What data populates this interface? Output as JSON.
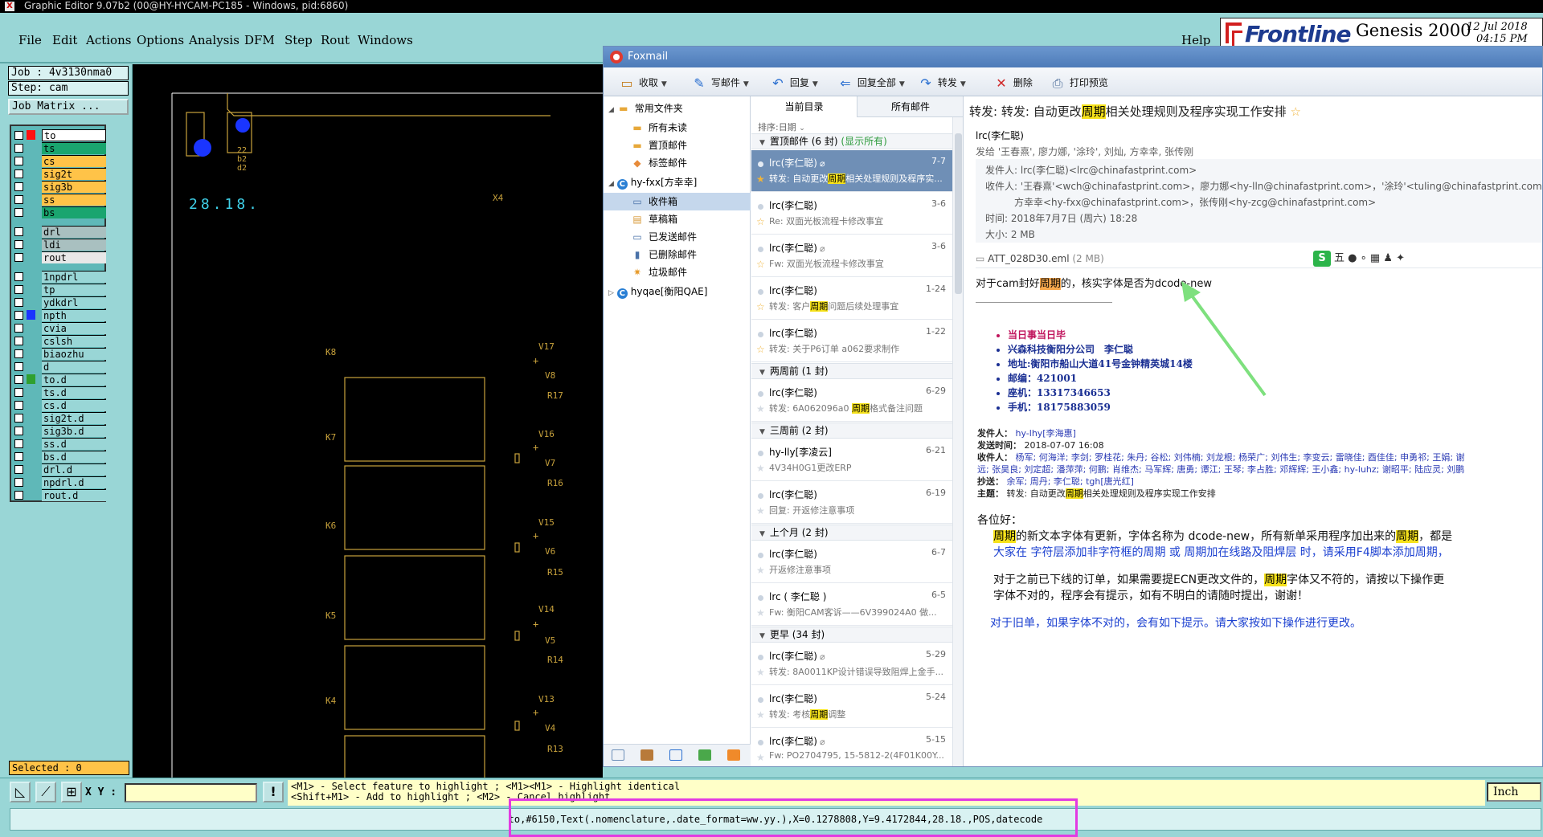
{
  "genesis": {
    "window_title": "Graphic Editor 9.07b2 (00@HY-HYCAM-PC185 - Windows, pid:6860)",
    "menu": [
      "File",
      "Edit",
      "Actions",
      "Options",
      "Analysis",
      "DFM",
      "Step",
      "Rout",
      "Windows"
    ],
    "help": "Help",
    "brand": {
      "frontline": "Frontline",
      "product": "Genesis 2000",
      "date": "12 Jul 2018",
      "time": "04:15 PM"
    },
    "job": "Job : 4v3130nma0",
    "step": "Step: cam",
    "job_matrix": "Job Matrix ...",
    "layers_group1": [
      "to",
      "ts",
      "cs",
      "sig2t",
      "sig3b",
      "ss",
      "bs"
    ],
    "layers_group2": [
      "drl",
      "ldi",
      "rout"
    ],
    "layers_group3": [
      "1npdrl",
      "tp",
      "ydkdrl",
      "npth",
      "cvia",
      "cslsh",
      "biaozhu",
      "d",
      "to.d",
      "ts.d",
      "cs.d",
      "sig2t.d",
      "sig3b.d",
      "ss.d",
      "bs.d",
      "drl.d",
      "npdrl.d",
      "rout.d"
    ],
    "selected": "Selected : 0",
    "canvas": {
      "date_text": "28.18.",
      "pad_labels": [
        "22",
        "b2",
        "d2"
      ],
      "x_label": "X4",
      "boxes": [
        {
          "k": "K8",
          "v1": "V17",
          "v2": "V8",
          "r": "R17"
        },
        {
          "k": "K7",
          "v1": "V16",
          "v2": "V7",
          "r": "R16"
        },
        {
          "k": "K6",
          "v1": "V15",
          "v2": "V6",
          "r": "R15"
        },
        {
          "k": "K5",
          "v1": "V14",
          "v2": "V5",
          "r": "R14"
        },
        {
          "k": "K4",
          "v1": "V13",
          "v2": "V4",
          "r": "R13"
        }
      ],
      "plus": "+"
    },
    "xy_label": "X Y :",
    "hint_line1": "<M1> - Select feature to highlight ; <M1><M1> - Highlight identical",
    "hint_line2": "<Shift+M1> - Add to highlight ; <M2> - Cancel highlight",
    "unit": "Inch",
    "status": "to,#6150,Text(.nomenclature,.date_format=ww.yy.),X=0.1278808,Y=9.4172844,28.18.,POS,datecode",
    "colors": {
      "teal": "#99d6d6",
      "orange": "#ffc348",
      "pcb_line": "#c8a23c",
      "pad_blue": "#1a35ff",
      "highlight": "#e23ae2"
    }
  },
  "foxmail": {
    "title": "Foxmail",
    "toolbar": [
      {
        "label": "收取",
        "icon": "inbox-icon"
      },
      {
        "label": "写邮件",
        "icon": "pen-icon"
      },
      {
        "label": "回复",
        "icon": "reply-icon"
      },
      {
        "label": "回复全部",
        "icon": "reply-all-icon"
      },
      {
        "label": "转发",
        "icon": "forward-icon"
      },
      {
        "label": "删除",
        "icon": "delete-icon"
      },
      {
        "label": "打印预览",
        "icon": "print-icon"
      }
    ],
    "folders": {
      "common": "常用文件夹",
      "all_unread": "所有未读",
      "pinned": "置顶邮件",
      "tagged": "标签邮件",
      "account1": "hy-fxx[方幸幸]",
      "inbox": "收件箱",
      "drafts": "草稿箱",
      "sent": "已发送邮件",
      "deleted": "已删除邮件",
      "junk": "垃圾邮件",
      "account2": "hyqae[衡阳QAE]"
    },
    "list_tabs": [
      "当前目录",
      "所有邮件"
    ],
    "sort": "排序:日期",
    "groups": {
      "pinned_count": "置顶邮件 (6 封)",
      "show_all": "(显示所有)",
      "two_weeks": "两周前 (1 封)",
      "three_weeks": "三周前 (2 封)",
      "last_month": "上个月 (2 封)",
      "older": "更早 (34 封)"
    },
    "messages": [
      {
        "from": "lrc(李仁聪)",
        "date": "7-7",
        "pre": "转发: 自动更改",
        "hl": "周期",
        "post": "相关处理规则及程序实..."
      },
      {
        "from": "lrc(李仁聪)",
        "date": "3-6",
        "pre": "Re: 双面光板流程卡修改事宜",
        "hl": "",
        "post": ""
      },
      {
        "from": "lrc(李仁聪)",
        "date": "3-6",
        "pre": "Fw: 双面光板流程卡修改事宜",
        "hl": "",
        "post": ""
      },
      {
        "from": "lrc(李仁聪)",
        "date": "1-24",
        "pre": "转发: 客户",
        "hl": "周期",
        "post": "问题后续处理事宜"
      },
      {
        "from": "lrc(李仁聪)",
        "date": "1-22",
        "pre": "转发: 关于P6订单 a062要求制作",
        "hl": "",
        "post": ""
      },
      {
        "from": "lrc(李仁聪)",
        "date": "6-29",
        "pre": "转发: 6A062096a0 ",
        "hl": "周期",
        "post": "格式备注问题"
      },
      {
        "from": "hy-lly[李凌云]",
        "date": "6-21",
        "pre": "4V34H0G1更改ERP",
        "hl": "",
        "post": ""
      },
      {
        "from": "lrc(李仁聪)",
        "date": "6-19",
        "pre": "回复: 开返修注意事项",
        "hl": "",
        "post": ""
      },
      {
        "from": "lrc(李仁聪)",
        "date": "6-7",
        "pre": "开返修注意事项",
        "hl": "",
        "post": ""
      },
      {
        "from": "lrc ( 李仁聪 )",
        "date": "6-5",
        "pre": "Fw: 衡阳CAM客诉——6V399024A0 做...",
        "hl": "",
        "post": ""
      },
      {
        "from": "lrc(李仁聪)",
        "date": "5-29",
        "pre": "转发: 8A0011KP设计错误导致阻焊上金手...",
        "hl": "",
        "post": ""
      },
      {
        "from": "lrc(李仁聪)",
        "date": "5-24",
        "pre": "转发: 考核",
        "hl": "周期",
        "post": "调整"
      },
      {
        "from": "lrc(李仁聪)",
        "date": "5-15",
        "pre": "Fw: PO2704795, 15-5812-2(4F01K00Y...",
        "hl": "",
        "post": ""
      }
    ],
    "read": {
      "subject_pre": "转发: 转发: 自动更改",
      "subject_hl": "周期",
      "subject_post": "相关处理规则及程序实现工作安排",
      "from_name": "lrc(李仁聪)",
      "sent_to": "发给 '王春熹', 廖力娜, '涂玲', 刘灿, 方幸幸, 张传刚",
      "sender": "发件人: lrc(李仁聪)<lrc@chinafastprint.com>",
      "recipients1": "收件人: '王春熹'<wch@chinafastprint.com>，廖力娜<hy-lln@chinafastprint.com>，'涂玲'<tuling@chinafastprint.com>",
      "recipients2": "方幸幸<hy-fxx@chinafastprint.com>，张传刚<hy-zcg@chinafastprint.com>",
      "time": "时间: 2018年7月7日 (周六) 18:28",
      "size": "大小: 2 MB",
      "attachment": "ATT_028D30.eml",
      "attachment_size": "(2 MB)",
      "ime": "五",
      "body_pre": "对于cam封好",
      "body_hl": "周期",
      "body_post": "的，核实字体是否为dcode-new",
      "signature": {
        "title": "当日事当日毕",
        "company": "兴森科技衡阳分公司　李仁聪",
        "address": "地址:衡阳市船山大道41号金钟精英城14楼",
        "zip": "邮编：421001",
        "phone": "座机：13317346653",
        "mobile": "手机：18175883059"
      },
      "fwd": {
        "sender_lbl": "发件人：",
        "sender": "hy-lhy[李海惠]",
        "time_lbl": "发送时间：",
        "time": "2018-07-07 16:08",
        "to_lbl": "收件人：",
        "to1": "杨军; 何海洋; 李剑; 罗桂花; 朱丹; 谷松; 刘伟楠; 刘龙根; 杨荣广; 刘伟生; 李变云; 雷晓佳; 酉佳佳; 申勇祁; 王娟; 谢",
        "to2": "远; 张昊良; 刘定超; 潘萍萍; 何鹏; 肖维杰; 马军辉; 唐勇; 谭江; 王琴; 李占胜; 邓辉辉; 王小鑫; hy-luhz; 谢昭平; 陆应灵; 刘鹏",
        "cc_lbl": "抄送：",
        "cc": "余军; 周丹; 李仁聪; tgh[唐光红]",
        "subj_lbl": "主题：",
        "subj_pre": "转发: 自动更改",
        "subj_hl": "周期",
        "subj_post": "相关处理规则及程序实现工作安排"
      },
      "greeting": "各位好：",
      "p1_hl": "周期",
      "p1_mid": "的新文本字体有更新，字体名称为 dcode-new，所有新单采用程序加出来的",
      "p1_hl2": "周期",
      "p1_end": "，都是",
      "p2": "大家在 字符层添加非字符框的周期 或 周期加在线路及阻焊层 时，请采用F4脚本添加周期，",
      "p3_pre": "对于之前已下线的订单，如果需要提ECN更改文件的，",
      "p3_hl": "周期",
      "p3_post": "字体又不符的，请按以下操作更",
      "p4": "字体不对的，程序会有提示，如有不明白的请随时提出，谢谢！",
      "p5": "对于旧单，如果字体不对的，会有如下提示。请大家按如下操作进行更改。"
    }
  }
}
